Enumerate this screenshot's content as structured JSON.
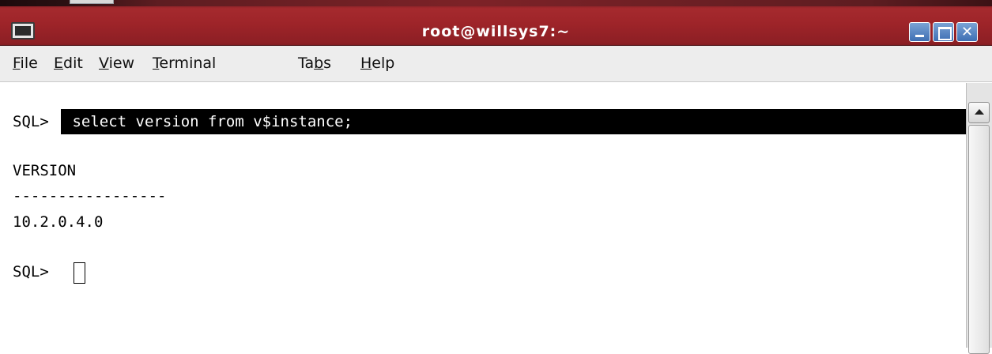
{
  "window": {
    "title": "root@willsys7:~"
  },
  "menu": {
    "items": [
      {
        "label": "File",
        "mnemonic": "F"
      },
      {
        "label": "Edit",
        "mnemonic": "E"
      },
      {
        "label": "View",
        "mnemonic": "V"
      },
      {
        "label": "Terminal",
        "mnemonic": "T"
      },
      {
        "label": "Tabs",
        "mnemonic": "b"
      },
      {
        "label": "Help",
        "mnemonic": "H"
      }
    ]
  },
  "terminal": {
    "prompt": "SQL>",
    "command": " select version from v$instance;",
    "output_header": "VERSION",
    "output_separator": "-----------------",
    "output_value": "10.2.0.4.0",
    "current_prompt": "SQL> "
  },
  "icons": {
    "window_icon": "terminal-icon",
    "minimize": "minimize-icon",
    "maximize": "maximize-icon",
    "close": "close-icon",
    "scroll_up": "arrow-up-icon"
  },
  "colors": {
    "titlebar": "#9e2429",
    "menubar": "#ededed",
    "terminal_bg": "#ffffff",
    "selection_bg": "#000000",
    "wm_button": "#4a7bbf"
  }
}
